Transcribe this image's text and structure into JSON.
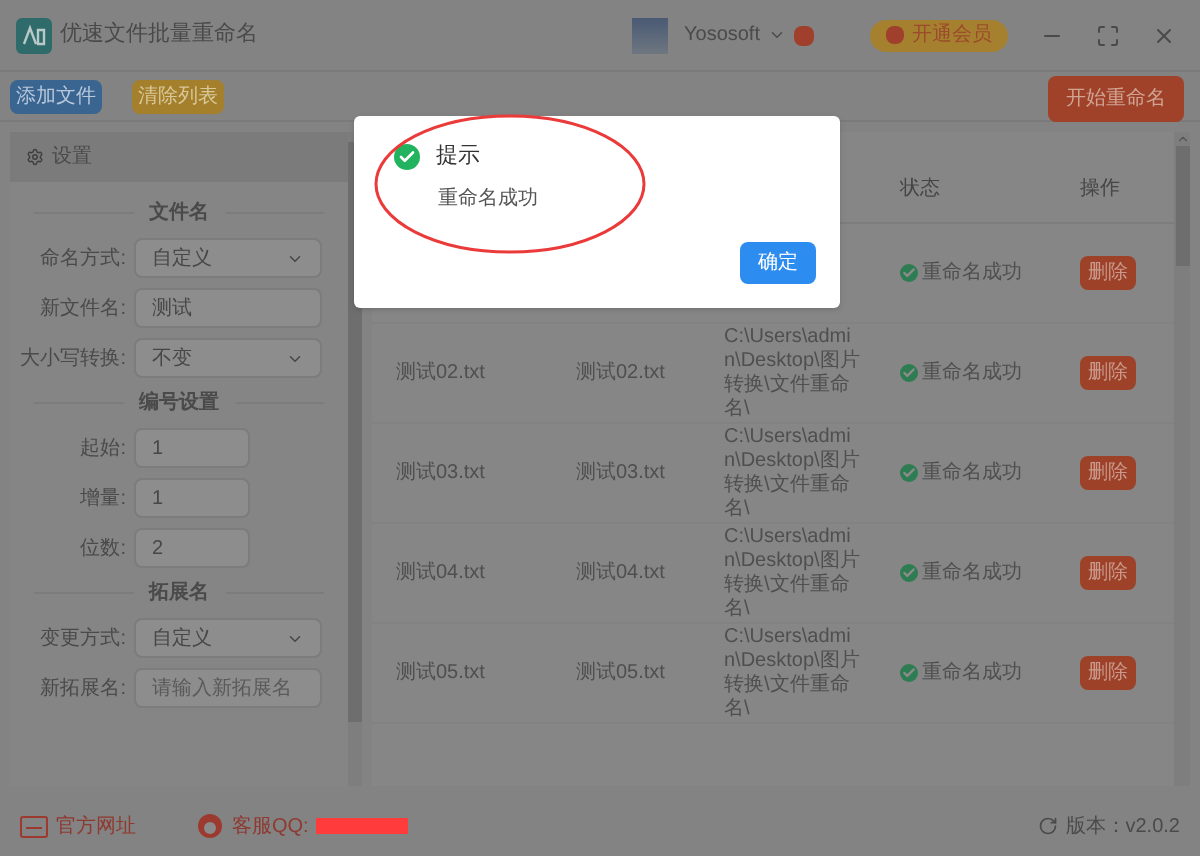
{
  "window": {
    "title": "优速文件批量重命名",
    "user": "Yososoft",
    "vip_button": "开通会员"
  },
  "toolbar": {
    "buttons": [
      {
        "label": "添加文件",
        "kind": "primary"
      },
      {
        "label": "清除列表",
        "kind": "warning"
      }
    ],
    "start_button": "开始重命名"
  },
  "settings": {
    "title": "设置",
    "sections": [
      {
        "title": "文件名",
        "fields": [
          {
            "label": "命名方式:",
            "value": "自定义",
            "kind": "select"
          },
          {
            "label": "新文件名:",
            "value": "测试",
            "kind": "text"
          },
          {
            "label": "大小写转换:",
            "value": "不变",
            "kind": "select"
          }
        ]
      },
      {
        "title": "编号设置",
        "fields": [
          {
            "label": "起始:",
            "value": "1",
            "kind": "short"
          },
          {
            "label": "增量:",
            "value": "1",
            "kind": "short"
          },
          {
            "label": "位数:",
            "value": "2",
            "kind": "short"
          }
        ]
      },
      {
        "title": "拓展名",
        "fields": [
          {
            "label": "变更方式:",
            "value": "自定义",
            "kind": "select"
          },
          {
            "label": "新拓展名:",
            "placeholder": "请输入新拓展名",
            "kind": "text"
          }
        ]
      }
    ]
  },
  "table": {
    "columns": [
      "状态",
      "操作"
    ],
    "rows": [
      {
        "status": "重命名成功",
        "action": "删除"
      },
      {
        "name": "测试02.txt",
        "new_name": "测试02.txt",
        "path": "C:\\Users\\admin\\Desktop\\图片转换\\文件重命名\\",
        "status": "重命名成功",
        "action": "删除"
      },
      {
        "name": "测试03.txt",
        "new_name": "测试03.txt",
        "path": "C:\\Users\\admin\\Desktop\\图片转换\\文件重命名\\",
        "status": "重命名成功",
        "action": "删除"
      },
      {
        "name": "测试04.txt",
        "new_name": "测试04.txt",
        "path": "C:\\Users\\admin\\Desktop\\图片转换\\文件重命名\\",
        "status": "重命名成功",
        "action": "删除"
      },
      {
        "name": "测试05.txt",
        "new_name": "测试05.txt",
        "path": "C:\\Users\\admin\\Desktop\\图片转换\\文件重命名\\",
        "status": "重命名成功",
        "action": "删除"
      }
    ]
  },
  "dialog": {
    "title": "提示",
    "message": "重命名成功",
    "ok_button": "确定"
  },
  "footer": {
    "website": "官方网址",
    "qq": "客服QQ:",
    "version": "版本：v2.0.2"
  }
}
